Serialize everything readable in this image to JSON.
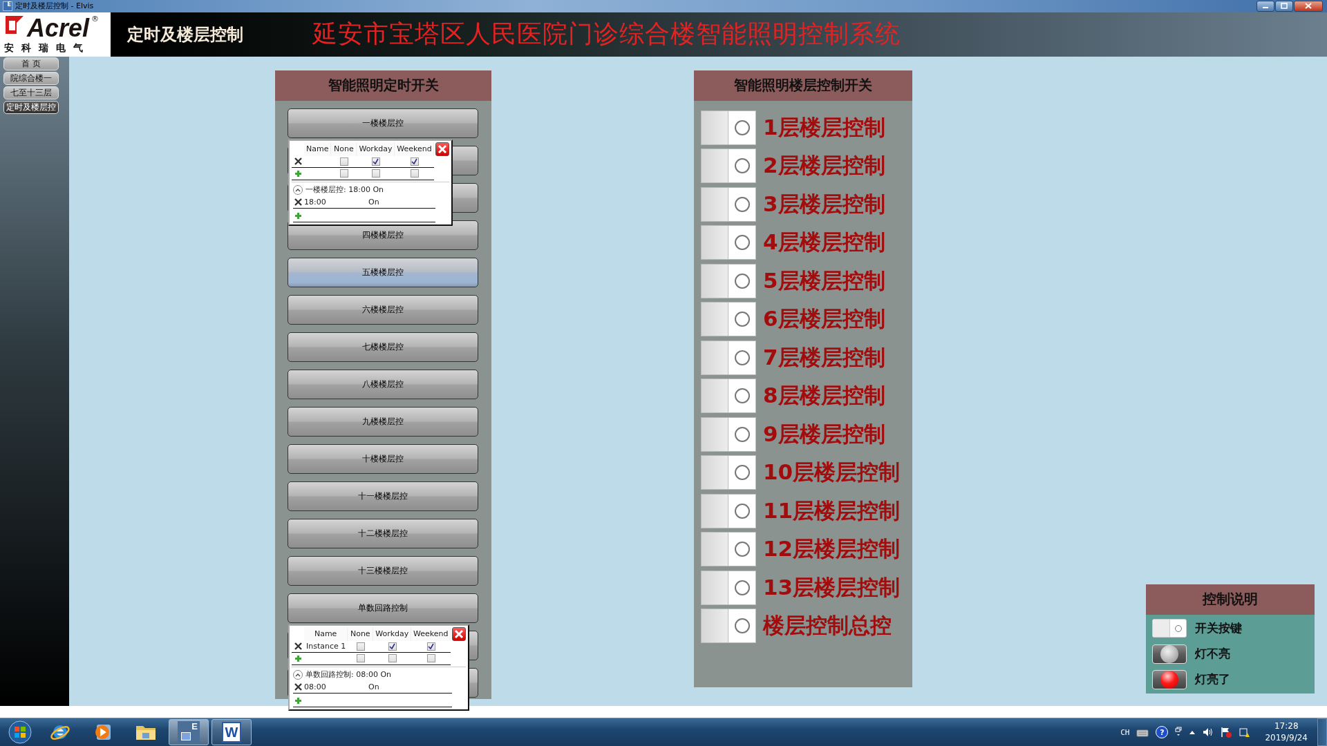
{
  "window": {
    "title": "定时及楼层控制 - Elvis",
    "icon_letter": "E"
  },
  "header": {
    "logo_text": "Acrel",
    "logo_mark": "®",
    "logo_subtitle": "安科瑞电气",
    "page_title": "定时及楼层控制",
    "system_title": "延安市宝塔区人民医院门诊综合楼智能照明控制系统"
  },
  "sidebar": {
    "items": [
      {
        "label": "首 页",
        "selected": false
      },
      {
        "label": "院综合楼一",
        "selected": false
      },
      {
        "label": "七至十三层",
        "selected": false
      },
      {
        "label": "定时及楼层控",
        "selected": true
      }
    ]
  },
  "timer_panel": {
    "title": "智能照明定时开关",
    "buttons": [
      {
        "label": "一楼楼层控",
        "selected": false,
        "popup": {
          "columns": [
            "Name",
            "None",
            "Workday",
            "Weekend"
          ],
          "rows": [
            {
              "kind": "entry",
              "none": false,
              "workday": true,
              "weekend": true
            },
            {
              "kind": "new",
              "none": false,
              "workday": false,
              "weekend": false
            }
          ],
          "schedule": {
            "summary": "一楼楼层控: 18:00 On",
            "expanded": true,
            "entries": [
              {
                "time": "18:00",
                "action": "On"
              }
            ]
          }
        }
      },
      {
        "selected": false
      },
      {
        "selected": false
      },
      {
        "label": "四楼楼层控",
        "selected": false
      },
      {
        "label": "五楼楼层控",
        "selected": true
      },
      {
        "label": "六楼楼层控",
        "selected": false
      },
      {
        "label": "七楼楼层控",
        "selected": false
      },
      {
        "label": "八楼楼层控",
        "selected": false
      },
      {
        "label": "九楼楼层控",
        "selected": false
      },
      {
        "label": "十楼楼层控",
        "selected": false
      },
      {
        "label": "十一楼楼层控",
        "selected": false
      },
      {
        "label": "十二楼楼层控",
        "selected": false
      },
      {
        "label": "十三楼楼层控",
        "selected": false
      },
      {
        "label": "单数回路控制",
        "selected": false,
        "popup": {
          "columns": [
            "Name",
            "None",
            "Workday",
            "Weekend"
          ],
          "rows": [
            {
              "kind": "entry",
              "name": "Instance 1",
              "none": false,
              "workday": true,
              "weekend": true
            },
            {
              "kind": "new",
              "none": false,
              "workday": false,
              "weekend": false
            }
          ],
          "schedule": {
            "summary": "单数回路控制: 08:00 On",
            "expanded": true,
            "entries": [
              {
                "time": "08:00",
                "action": "On"
              }
            ]
          }
        }
      },
      {
        "selected": false
      },
      {
        "selected": false
      }
    ]
  },
  "floor_panel": {
    "title": "智能照明楼层控制开关",
    "items": [
      {
        "label": "1层楼层控制",
        "on": false
      },
      {
        "label": "2层楼层控制",
        "on": false
      },
      {
        "label": "3层楼层控制",
        "on": false
      },
      {
        "label": "4层楼层控制",
        "on": false
      },
      {
        "label": "5层楼层控制",
        "on": false
      },
      {
        "label": "6层楼层控制",
        "on": false
      },
      {
        "label": "7层楼层控制",
        "on": false
      },
      {
        "label": "8层楼层控制",
        "on": false
      },
      {
        "label": "9层楼层控制",
        "on": false
      },
      {
        "label": "10层楼层控制",
        "on": false
      },
      {
        "label": "11层楼层控制",
        "on": false
      },
      {
        "label": "12层楼层控制",
        "on": false
      },
      {
        "label": "13层楼层控制",
        "on": false
      },
      {
        "label": "楼层控制总控",
        "on": false
      }
    ]
  },
  "legend": {
    "title": "控制说明",
    "items": [
      {
        "kind": "switch",
        "label": "开关按键"
      },
      {
        "kind": "lamp_off",
        "label": "灯不亮"
      },
      {
        "kind": "lamp_on",
        "label": "灯亮了"
      }
    ]
  },
  "taskbar": {
    "apps": [
      {
        "kind": "browser",
        "selected": false,
        "running": false
      },
      {
        "kind": "media",
        "selected": false,
        "running": false
      },
      {
        "kind": "folder",
        "selected": false,
        "running": false
      },
      {
        "kind": "app",
        "label": "E",
        "selected": true,
        "running": true
      },
      {
        "kind": "document",
        "label": "W",
        "selected": false,
        "running": true
      }
    ],
    "tray": {
      "language": "CH",
      "help_glyph": "?",
      "time": "17:28",
      "date": "2019/9/24"
    }
  }
}
